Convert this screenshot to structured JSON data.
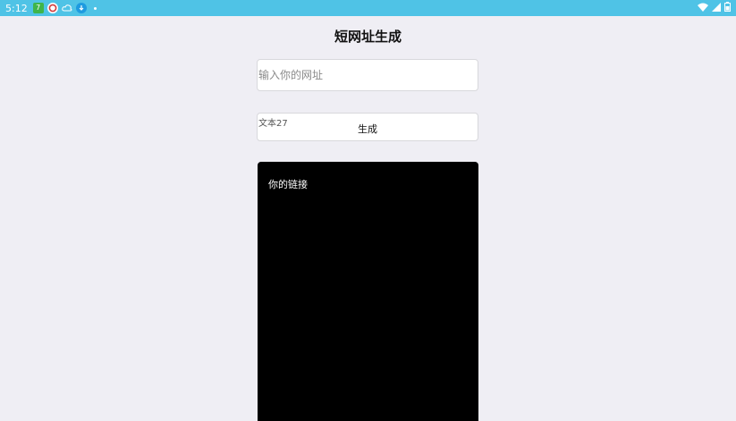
{
  "status_bar": {
    "time": "5:12",
    "notification_icons": [
      "green-app-icon",
      "red-app-icon",
      "cloud-icon",
      "download-icon"
    ],
    "system_icons": [
      "wifi-icon",
      "signal-icon",
      "battery-icon"
    ]
  },
  "page": {
    "title": "短网址生成",
    "url_input": {
      "placeholder": "输入你的网址",
      "value": ""
    },
    "generate_button": {
      "small_text": "文本27",
      "label": "生成"
    },
    "result": {
      "text": "你的链接"
    }
  },
  "colors": {
    "status_bar": "#4fc3e6",
    "background": "#efeef4",
    "result_panel": "#000000"
  }
}
